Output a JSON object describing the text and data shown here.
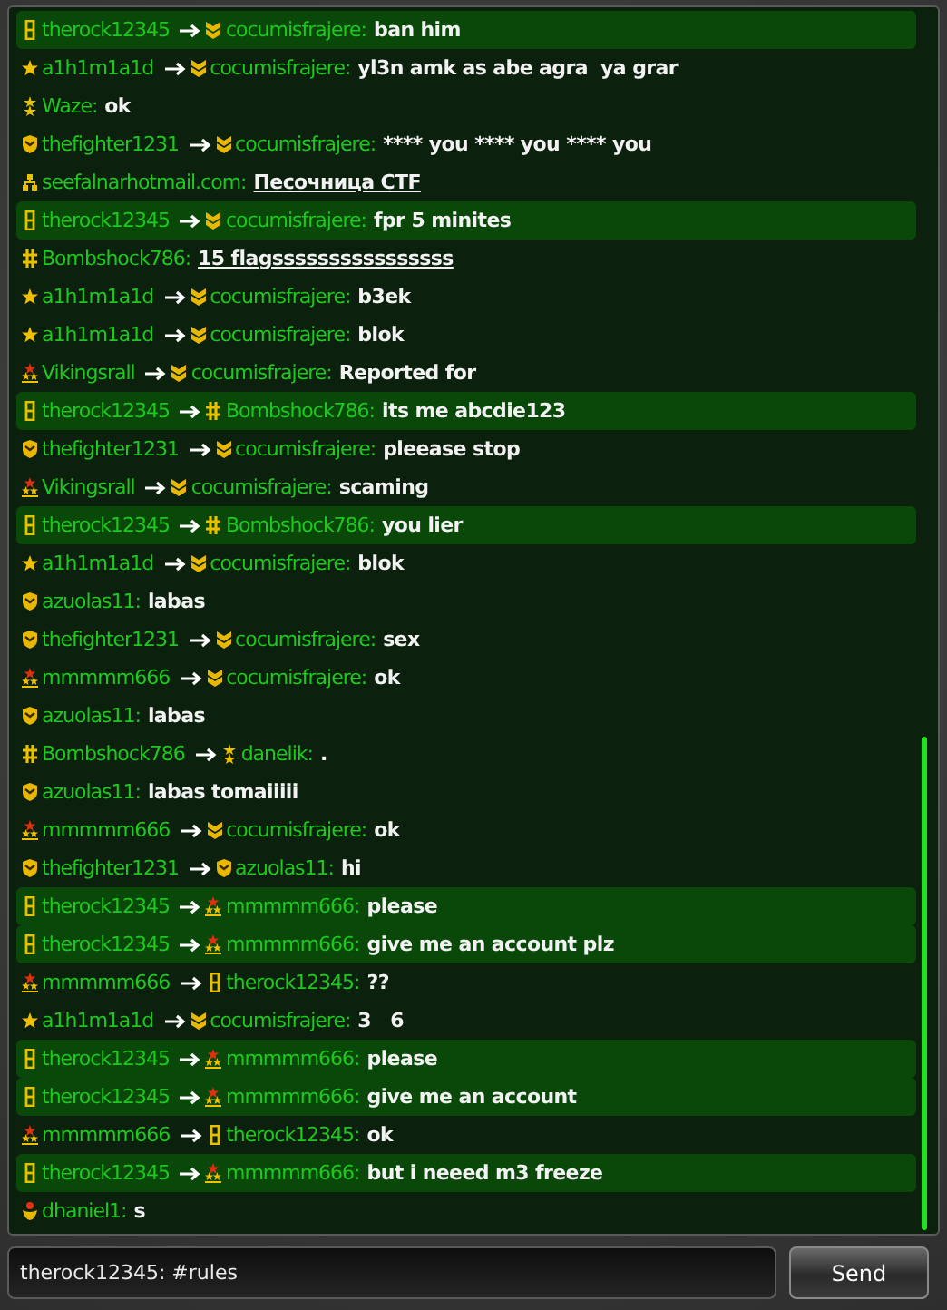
{
  "messages": [
    {
      "sender": {
        "name": "therock12345",
        "kind": "cadet"
      },
      "recipient": {
        "name": "cocumisfrajere:",
        "kind": "chevron"
      },
      "text": "ban him",
      "highlighted": true,
      "link": false
    },
    {
      "sender": {
        "name": "a1h1m1a1d",
        "kind": "star"
      },
      "recipient": {
        "name": "cocumisfrajere:",
        "kind": "chevron"
      },
      "text": "yl3n amk as abe agra  ya grar",
      "highlighted": false,
      "link": false
    },
    {
      "sender": {
        "name": "Waze:",
        "kind": "stars2"
      },
      "text": "ok",
      "highlighted": false,
      "link": false
    },
    {
      "sender": {
        "name": "thefighter1231",
        "kind": "shield"
      },
      "recipient": {
        "name": "cocumisfrajere:",
        "kind": "chevron"
      },
      "text": "**** you **** you **** you",
      "highlighted": false,
      "link": false
    },
    {
      "sender": {
        "name": "seefalnarhotmail.com:",
        "kind": "org"
      },
      "text": "Песочница CTF",
      "highlighted": false,
      "link": true
    },
    {
      "sender": {
        "name": "therock12345",
        "kind": "cadet"
      },
      "recipient": {
        "name": "cocumisfrajere:",
        "kind": "chevron"
      },
      "text": "fpr 5 minites",
      "highlighted": true,
      "link": false
    },
    {
      "sender": {
        "name": "Bombshock786:",
        "kind": "hash"
      },
      "text": "15 flagssssssssssssssss",
      "highlighted": false,
      "link": true
    },
    {
      "sender": {
        "name": "a1h1m1a1d",
        "kind": "star"
      },
      "recipient": {
        "name": "cocumisfrajere:",
        "kind": "chevron"
      },
      "text": "b3ek",
      "highlighted": false,
      "link": false
    },
    {
      "sender": {
        "name": "a1h1m1a1d",
        "kind": "star"
      },
      "recipient": {
        "name": "cocumisfrajere:",
        "kind": "chevron"
      },
      "text": "blok",
      "highlighted": false,
      "link": false
    },
    {
      "sender": {
        "name": "Vikingsrall",
        "kind": "crown"
      },
      "recipient": {
        "name": "cocumisfrajere:",
        "kind": "chevron"
      },
      "text": "Reported for",
      "highlighted": false,
      "link": false
    },
    {
      "sender": {
        "name": "therock12345",
        "kind": "cadet"
      },
      "recipient": {
        "name": "Bombshock786:",
        "kind": "hash"
      },
      "text": "its me abcdie123",
      "highlighted": true,
      "link": false
    },
    {
      "sender": {
        "name": "thefighter1231",
        "kind": "shield"
      },
      "recipient": {
        "name": "cocumisfrajere:",
        "kind": "chevron"
      },
      "text": "pleease stop",
      "highlighted": false,
      "link": false
    },
    {
      "sender": {
        "name": "Vikingsrall",
        "kind": "crown"
      },
      "recipient": {
        "name": "cocumisfrajere:",
        "kind": "chevron"
      },
      "text": "scaming",
      "highlighted": false,
      "link": false
    },
    {
      "sender": {
        "name": "therock12345",
        "kind": "cadet"
      },
      "recipient": {
        "name": "Bombshock786:",
        "kind": "hash"
      },
      "text": "you lier",
      "highlighted": true,
      "link": false
    },
    {
      "sender": {
        "name": "a1h1m1a1d",
        "kind": "star"
      },
      "recipient": {
        "name": "cocumisfrajere:",
        "kind": "chevron"
      },
      "text": "blok",
      "highlighted": false,
      "link": false
    },
    {
      "sender": {
        "name": "azuolas11:",
        "kind": "shield"
      },
      "text": "labas",
      "highlighted": false,
      "link": false
    },
    {
      "sender": {
        "name": "thefighter1231",
        "kind": "shield"
      },
      "recipient": {
        "name": "cocumisfrajere:",
        "kind": "chevron"
      },
      "text": "sex",
      "highlighted": false,
      "link": false
    },
    {
      "sender": {
        "name": "mmmmm666",
        "kind": "crown"
      },
      "recipient": {
        "name": "cocumisfrajere:",
        "kind": "chevron"
      },
      "text": "ok",
      "highlighted": false,
      "link": false
    },
    {
      "sender": {
        "name": "azuolas11:",
        "kind": "shield"
      },
      "text": "labas",
      "highlighted": false,
      "link": false
    },
    {
      "sender": {
        "name": "Bombshock786",
        "kind": "hash"
      },
      "recipient": {
        "name": "danelik:",
        "kind": "stars2"
      },
      "text": ".",
      "highlighted": false,
      "link": false
    },
    {
      "sender": {
        "name": "azuolas11:",
        "kind": "shield"
      },
      "text": "labas tomaiiiii",
      "highlighted": false,
      "link": false
    },
    {
      "sender": {
        "name": "mmmmm666",
        "kind": "crown"
      },
      "recipient": {
        "name": "cocumisfrajere:",
        "kind": "chevron"
      },
      "text": "ok",
      "highlighted": false,
      "link": false
    },
    {
      "sender": {
        "name": "thefighter1231",
        "kind": "shield"
      },
      "recipient": {
        "name": "azuolas11:",
        "kind": "shield"
      },
      "text": "hi",
      "highlighted": false,
      "link": false
    },
    {
      "sender": {
        "name": "therock12345",
        "kind": "cadet"
      },
      "recipient": {
        "name": "mmmmm666:",
        "kind": "crown"
      },
      "text": "please",
      "highlighted": true,
      "link": false
    },
    {
      "sender": {
        "name": "therock12345",
        "kind": "cadet"
      },
      "recipient": {
        "name": "mmmmm666:",
        "kind": "crown"
      },
      "text": "give me an account plz",
      "highlighted": true,
      "link": false
    },
    {
      "sender": {
        "name": "mmmmm666",
        "kind": "crown"
      },
      "recipient": {
        "name": "therock12345:",
        "kind": "cadet"
      },
      "text": "??",
      "highlighted": false,
      "link": false
    },
    {
      "sender": {
        "name": "a1h1m1a1d",
        "kind": "star"
      },
      "recipient": {
        "name": "cocumisfrajere:",
        "kind": "chevron"
      },
      "text": "3   6",
      "highlighted": false,
      "link": false
    },
    {
      "sender": {
        "name": "therock12345",
        "kind": "cadet"
      },
      "recipient": {
        "name": "mmmmm666:",
        "kind": "crown"
      },
      "text": "please",
      "highlighted": true,
      "link": false
    },
    {
      "sender": {
        "name": "therock12345",
        "kind": "cadet"
      },
      "recipient": {
        "name": "mmmmm666:",
        "kind": "crown"
      },
      "text": "give me an account",
      "highlighted": true,
      "link": false
    },
    {
      "sender": {
        "name": "mmmmm666",
        "kind": "crown"
      },
      "recipient": {
        "name": "therock12345:",
        "kind": "cadet"
      },
      "text": "ok",
      "highlighted": false,
      "link": false
    },
    {
      "sender": {
        "name": "therock12345",
        "kind": "cadet"
      },
      "recipient": {
        "name": "mmmmm666:",
        "kind": "crown"
      },
      "text": "but i neeed m3 freeze",
      "highlighted": true,
      "link": false
    },
    {
      "sender": {
        "name": "dhaniel1:",
        "kind": "flower"
      },
      "text": "s",
      "highlighted": false,
      "link": false
    }
  ],
  "input": {
    "value": "therock12345: #rules"
  },
  "send_button": {
    "label": "Send"
  }
}
